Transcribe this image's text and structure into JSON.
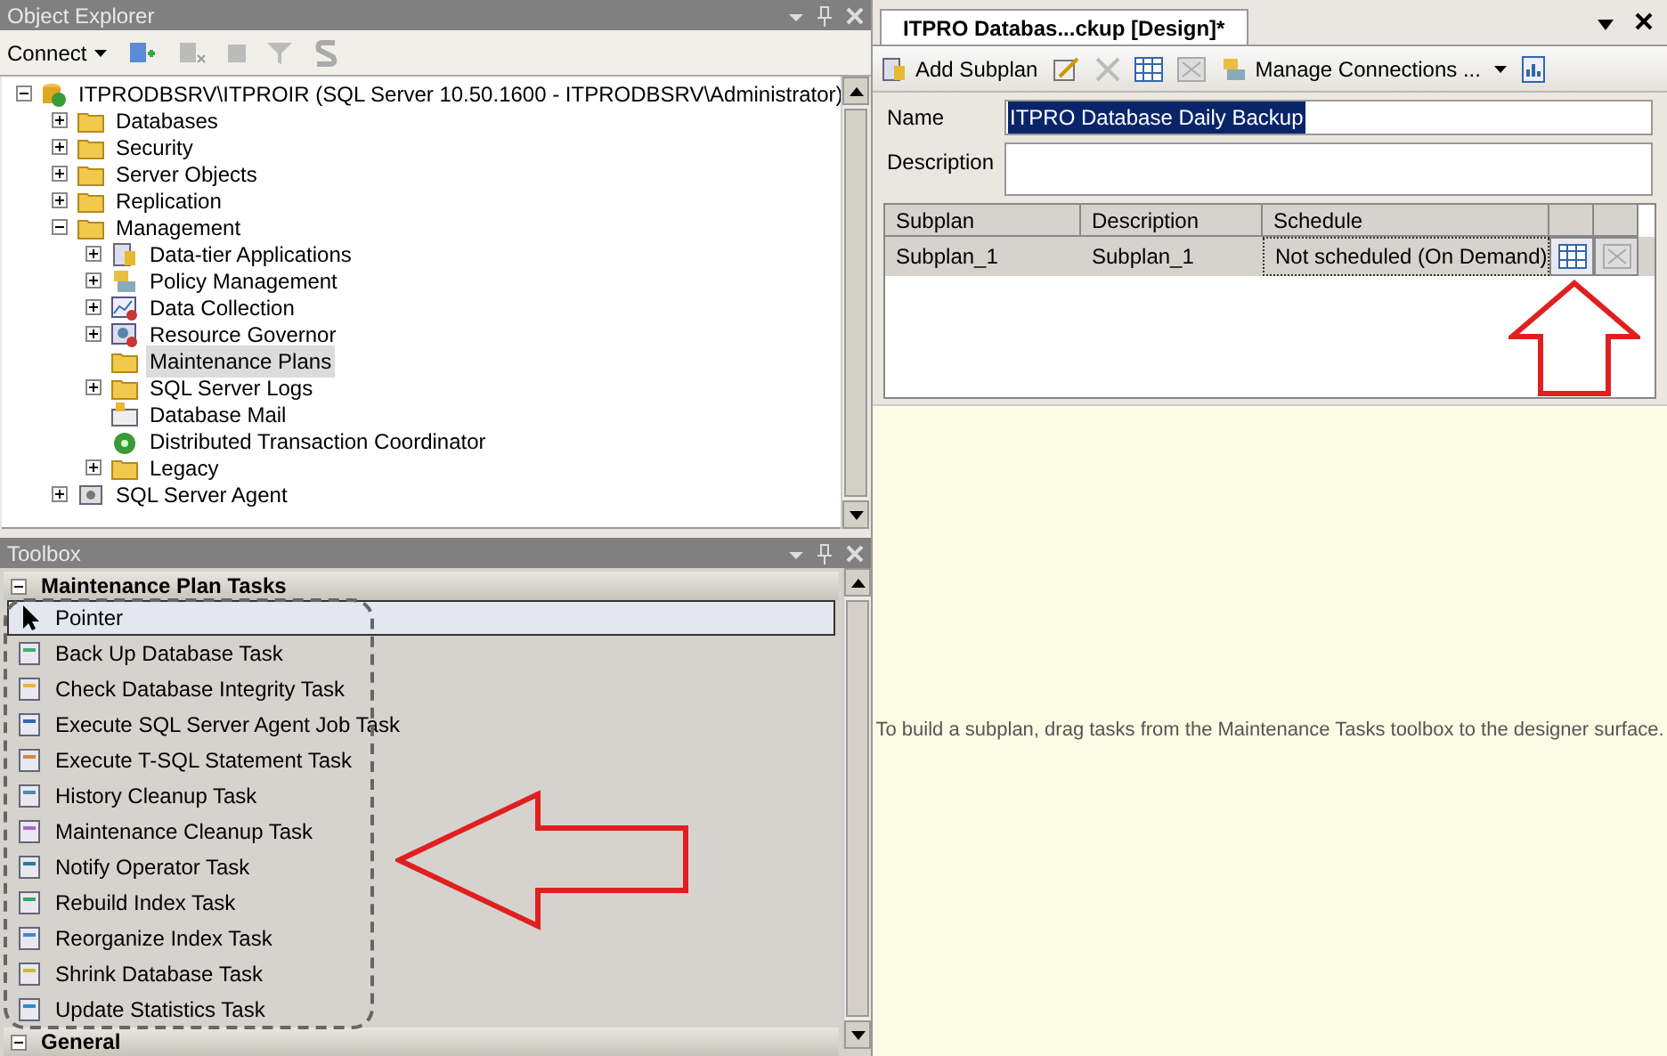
{
  "object_explorer": {
    "title": "Object Explorer",
    "connect_label": "Connect",
    "tree": [
      {
        "label": "ITPRODBSRV\\ITPROIR (SQL Server 10.50.1600 - ITPRODBSRV\\Administrator)",
        "kind": "server",
        "expanded": true,
        "selected": false,
        "children": [
          {
            "label": "Databases",
            "kind": "folder",
            "expanded": false,
            "selected": false
          },
          {
            "label": "Security",
            "kind": "folder",
            "expanded": false,
            "selected": false
          },
          {
            "label": "Server Objects",
            "kind": "folder",
            "expanded": false,
            "selected": false
          },
          {
            "label": "Replication",
            "kind": "folder",
            "expanded": false,
            "selected": false
          },
          {
            "label": "Management",
            "kind": "folder",
            "expanded": true,
            "selected": false,
            "children": [
              {
                "label": "Data-tier Applications",
                "kind": "app",
                "expanded": false,
                "selected": false
              },
              {
                "label": "Policy Management",
                "kind": "policy",
                "expanded": false,
                "selected": false
              },
              {
                "label": "Data Collection",
                "kind": "chart",
                "expanded": false,
                "selected": false
              },
              {
                "label": "Resource Governor",
                "kind": "governor",
                "expanded": false,
                "selected": false
              },
              {
                "label": "Maintenance Plans",
                "kind": "folder",
                "selected": true
              },
              {
                "label": "SQL Server Logs",
                "kind": "folder",
                "expanded": false,
                "selected": false
              },
              {
                "label": "Database Mail",
                "kind": "mail",
                "selected": false
              },
              {
                "label": "Distributed Transaction Coordinator",
                "kind": "coordinator",
                "selected": false
              },
              {
                "label": "Legacy",
                "kind": "folder",
                "expanded": false,
                "selected": false
              }
            ]
          },
          {
            "label": "SQL Server Agent",
            "kind": "agent",
            "expanded": false,
            "selected": false
          }
        ]
      }
    ]
  },
  "toolbox": {
    "title": "Toolbox",
    "sections": [
      {
        "label": "Maintenance Plan Tasks",
        "expanded": true,
        "items": [
          {
            "label": "Pointer",
            "selected": true
          },
          {
            "label": "Back Up Database Task",
            "selected": false
          },
          {
            "label": "Check Database Integrity Task",
            "selected": false
          },
          {
            "label": "Execute SQL Server Agent Job Task",
            "selected": false
          },
          {
            "label": "Execute T-SQL Statement Task",
            "selected": false
          },
          {
            "label": "History Cleanup Task",
            "selected": false
          },
          {
            "label": "Maintenance Cleanup Task",
            "selected": false
          },
          {
            "label": "Notify Operator Task",
            "selected": false
          },
          {
            "label": "Rebuild Index Task",
            "selected": false
          },
          {
            "label": "Reorganize Index Task",
            "selected": false
          },
          {
            "label": "Shrink Database Task",
            "selected": false
          },
          {
            "label": "Update Statistics Task",
            "selected": false
          }
        ]
      },
      {
        "label": "General",
        "expanded": true
      }
    ]
  },
  "designer": {
    "tab": {
      "label": "ITPRO Databas...ckup [Design]*",
      "selected": true
    },
    "add_subplan": "Add Subplan",
    "manage_connections": "Manage Connections ...",
    "name_label": "Name",
    "name_value": "ITPRO Database Daily Backup",
    "description_label": "Description",
    "grid": {
      "columns": [
        "Subplan",
        "Description",
        "Schedule"
      ],
      "rows": [
        {
          "cells": [
            "Subplan_1",
            "Subplan_1",
            "Not scheduled (On Demand)"
          ],
          "selected": true
        }
      ]
    },
    "hint": "To build a subplan, drag tasks from the Maintenance Tasks toolbox to the designer surface."
  }
}
